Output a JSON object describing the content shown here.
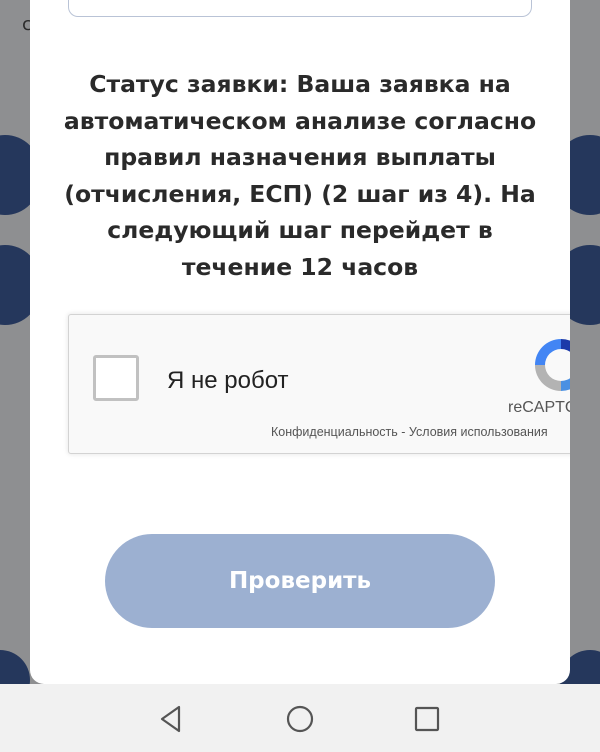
{
  "background": {
    "letter": "c"
  },
  "modal": {
    "status_text": "Статус заявки: Ваша заявка на автоматическом анализе согласно правил назначения выплаты (отчисления, ЕСП) (2 шаг из 4). На следующий шаг перейдет в течение 12 часов",
    "recaptcha": {
      "label": "Я не робот",
      "brand": "reCAPTCHA",
      "links": "Конфиденциальность - Условия использования"
    },
    "check_button_label": "Проверить"
  },
  "nav_bar": {
    "icons": [
      "back-triangle-icon",
      "home-circle-icon",
      "recent-square-icon"
    ]
  },
  "colors": {
    "button_bg": "#9cb0d1",
    "overlay_bg": "#8e8f91",
    "blob": "#25375c",
    "text": "#2a2a2a"
  }
}
